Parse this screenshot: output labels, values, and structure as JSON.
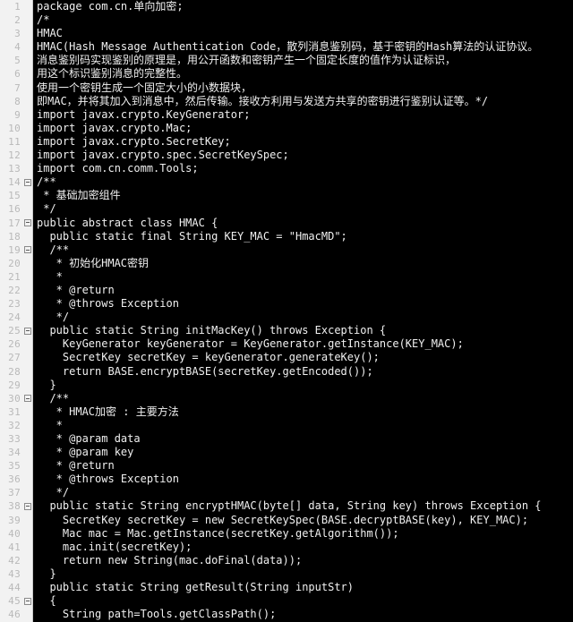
{
  "editor": {
    "app_kind": "code-editor",
    "language": "Java",
    "theme": {
      "background": "#000000",
      "foreground": "#f0f0f0",
      "gutter_background": "#f2f2f2",
      "gutter_foreground": "#b9b9b9",
      "gutter_border": "#c8c8c8",
      "fold_marker": "#8a8a8a"
    },
    "first_visible_line": 1,
    "last_visible_line": 46,
    "total_visible_lines": 46
  },
  "fold_markers": {
    "icon": "fold-collapse-icon",
    "lines": [
      14,
      17,
      19,
      25,
      30,
      38,
      45
    ]
  },
  "lines": [
    {
      "n": 1,
      "text": "package com.cn.单向加密;"
    },
    {
      "n": 2,
      "text": "/*"
    },
    {
      "n": 3,
      "text": "HMAC"
    },
    {
      "n": 4,
      "text": "HMAC(Hash Message Authentication Code，散列消息鉴别码，基于密钥的Hash算法的认证协议。"
    },
    {
      "n": 5,
      "text": "消息鉴别码实现鉴别的原理是，用公开函数和密钥产生一个固定长度的值作为认证标识，"
    },
    {
      "n": 6,
      "text": "用这个标识鉴别消息的完整性。"
    },
    {
      "n": 7,
      "text": "使用一个密钥生成一个固定大小的小数据块，"
    },
    {
      "n": 8,
      "text": "即MAC，并将其加入到消息中，然后传输。接收方利用与发送方共享的密钥进行鉴别认证等。*/"
    },
    {
      "n": 9,
      "text": "import javax.crypto.KeyGenerator;"
    },
    {
      "n": 10,
      "text": "import javax.crypto.Mac;"
    },
    {
      "n": 11,
      "text": "import javax.crypto.SecretKey;"
    },
    {
      "n": 12,
      "text": "import javax.crypto.spec.SecretKeySpec;"
    },
    {
      "n": 13,
      "text": "import com.cn.comm.Tools;"
    },
    {
      "n": 14,
      "text": "/**"
    },
    {
      "n": 15,
      "text": " * 基础加密组件"
    },
    {
      "n": 16,
      "text": " */"
    },
    {
      "n": 17,
      "text": "public abstract class HMAC {"
    },
    {
      "n": 18,
      "text": "  public static final String KEY_MAC = \"HmacMD\";"
    },
    {
      "n": 19,
      "text": "  /**"
    },
    {
      "n": 20,
      "text": "   * 初始化HMAC密钥"
    },
    {
      "n": 21,
      "text": "   *"
    },
    {
      "n": 22,
      "text": "   * @return"
    },
    {
      "n": 23,
      "text": "   * @throws Exception"
    },
    {
      "n": 24,
      "text": "   */"
    },
    {
      "n": 25,
      "text": "  public static String initMacKey() throws Exception {"
    },
    {
      "n": 26,
      "text": "    KeyGenerator keyGenerator = KeyGenerator.getInstance(KEY_MAC);"
    },
    {
      "n": 27,
      "text": "    SecretKey secretKey = keyGenerator.generateKey();"
    },
    {
      "n": 28,
      "text": "    return BASE.encryptBASE(secretKey.getEncoded());"
    },
    {
      "n": 29,
      "text": "  }"
    },
    {
      "n": 30,
      "text": "  /**"
    },
    {
      "n": 31,
      "text": "   * HMAC加密 : 主要方法"
    },
    {
      "n": 32,
      "text": "   *"
    },
    {
      "n": 33,
      "text": "   * @param data"
    },
    {
      "n": 34,
      "text": "   * @param key"
    },
    {
      "n": 35,
      "text": "   * @return"
    },
    {
      "n": 36,
      "text": "   * @throws Exception"
    },
    {
      "n": 37,
      "text": "   */"
    },
    {
      "n": 38,
      "text": "  public static String encryptHMAC(byte[] data, String key) throws Exception {"
    },
    {
      "n": 39,
      "text": "    SecretKey secretKey = new SecretKeySpec(BASE.decryptBASE(key), KEY_MAC);"
    },
    {
      "n": 40,
      "text": "    Mac mac = Mac.getInstance(secretKey.getAlgorithm());"
    },
    {
      "n": 41,
      "text": "    mac.init(secretKey);"
    },
    {
      "n": 42,
      "text": "    return new String(mac.doFinal(data));"
    },
    {
      "n": 43,
      "text": "  }"
    },
    {
      "n": 44,
      "text": "  public static String getResult(String inputStr)"
    },
    {
      "n": 45,
      "text": "  {"
    },
    {
      "n": 46,
      "text": "    String path=Tools.getClassPath();"
    }
  ]
}
